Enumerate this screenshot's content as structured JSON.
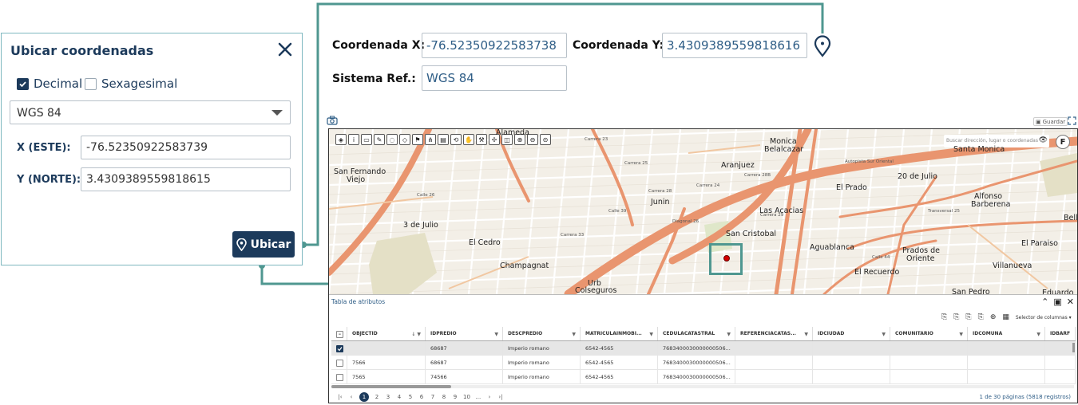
{
  "panel": {
    "title": "Ubicar coordenadas",
    "decimal_label": "Decimal",
    "decimal_checked": true,
    "sexagesimal_label": "Sexagesimal",
    "sexagesimal_checked": false,
    "crs_selected": "WGS 84",
    "x_label": "X (ESTE):",
    "x_value": "-76.52350922583739",
    "y_label": "Y (NORTE):",
    "y_value": "3.4309389559818615",
    "locate_button": "Ubicar"
  },
  "header": {
    "x_label": "Coordenada X:",
    "x_value": "-76.52350922583738",
    "y_label": "Coordenada Y:",
    "y_value": "3.4309389559818616",
    "ref_label": "Sistema Ref.:",
    "ref_value": "WGS 84"
  },
  "map": {
    "save_label": "Guardar",
    "search_placeholder": "Buscar dirección, lugar o coordenadas",
    "f_button": "F",
    "places": [
      {
        "name": "Alameda",
        "style": "left:209px;top:-1px;"
      },
      {
        "name": "Monica",
        "style": "left:552px;top:10px;"
      },
      {
        "name": "Belalcazar",
        "style": "left:545px;top:20px;"
      },
      {
        "name": "Santa Monica",
        "style": "left:782px;top:20px;"
      },
      {
        "name": "Aranjuez",
        "style": "left:491px;top:40px;"
      },
      {
        "name": "San Fernando",
        "style": "left:6px;top:48px;"
      },
      {
        "name": "Viejo",
        "style": "left:22px;top:58px;"
      },
      {
        "name": "20 de Julio",
        "style": "left:712px;top:54px;"
      },
      {
        "name": "El Prado",
        "style": "left:635px;top:68px;"
      },
      {
        "name": "Alfonso",
        "style": "left:808px;top:79px;"
      },
      {
        "name": "Barberena",
        "style": "left:804px;top:89px;"
      },
      {
        "name": "Junin",
        "style": "left:403px;top:86px;"
      },
      {
        "name": "Las Acacias",
        "style": "left:539px;top:97px;"
      },
      {
        "name": "Bello",
        "style": "left:920px;top:106px;"
      },
      {
        "name": "3 de Julio",
        "style": "left:93px;top:115px;"
      },
      {
        "name": "San Cristobal",
        "style": "left:497px;top:126px;"
      },
      {
        "name": "El Cedro",
        "style": "left:175px;top:137px;"
      },
      {
        "name": "Aguablanca",
        "style": "left:602px;top:143px;"
      },
      {
        "name": "El Paraiso",
        "style": "left:867px;top:138px;"
      },
      {
        "name": "Prados de",
        "style": "left:718px;top:147px;"
      },
      {
        "name": "Oriente",
        "style": "left:723px;top:157px;"
      },
      {
        "name": "Champagnat",
        "style": "left:214px;top:166px;"
      },
      {
        "name": "Villanueva",
        "style": "left:831px;top:166px;"
      },
      {
        "name": "El Recuerdo",
        "style": "left:658px;top:174px;"
      },
      {
        "name": "Urb",
        "style": "left:324px;top:188px;"
      },
      {
        "name": "Colseguros",
        "style": "left:308px;top:197px;"
      },
      {
        "name": "San Pedro",
        "style": "left:780px;top:199px;"
      },
      {
        "name": "Eduardo",
        "style": "left:893px;top:200px;"
      }
    ],
    "streets": [
      {
        "name": "Carrera 23",
        "style": "left:320px;top:10px;"
      },
      {
        "name": "Carrera 25",
        "style": "left:370px;top:40px;"
      },
      {
        "name": "Carrera 28",
        "style": "left:400px;top:75px;"
      },
      {
        "name": "Carrera 24",
        "style": "left:460px;top:68px;"
      },
      {
        "name": "Carrera 33",
        "style": "left:290px;top:130px;"
      },
      {
        "name": "Calle 39",
        "style": "left:350px;top:100px;"
      },
      {
        "name": "Diagonal 26",
        "style": "left:430px;top:113px;"
      },
      {
        "name": "Autopista Sur Oriental",
        "style": "left:646px;top:38px;"
      },
      {
        "name": "Transversal 25",
        "style": "left:750px;top:100px;"
      },
      {
        "name": "Calle 44",
        "style": "left:680px;top:158px;"
      },
      {
        "name": "Carrera 28B",
        "style": "left:520px;top:55px;"
      },
      {
        "name": "Calle 26",
        "style": "left:110px;top:80px;"
      },
      {
        "name": "Carrera 29",
        "style": "left:540px;top:105px;"
      }
    ]
  },
  "table": {
    "title": "Tabla de atributos",
    "column_selector": "Selector de columnas",
    "columns": [
      "OBJECTID",
      "IDPREDIO",
      "DESCPREDIO",
      "MATRICULAINMOBI...",
      "CEDULACATASTRAL",
      "REFERENCIACATAS...",
      "IDCIUDAD",
      "COMUNITARIO",
      "IDCOMUNA",
      "IDBARF"
    ],
    "rows": [
      {
        "checked": true,
        "cells": [
          "",
          "68687",
          "Imperio romano",
          "6542-4565",
          "7683400030000000506...",
          "",
          "",
          "",
          "",
          ""
        ]
      },
      {
        "checked": false,
        "cells": [
          "7566",
          "68687",
          "Imperio romano",
          "6542-4565",
          "7683400030000000506...",
          "",
          "",
          "",
          "",
          ""
        ]
      },
      {
        "checked": false,
        "cells": [
          "7565",
          "74566",
          "Imperio romano",
          "6542-4565",
          "7683400030000000506...",
          "",
          "",
          "",
          "",
          ""
        ]
      }
    ],
    "pages": [
      "1",
      "2",
      "3",
      "4",
      "5",
      "6",
      "7",
      "8",
      "9",
      "10",
      "..."
    ],
    "active_page": "1",
    "pager_info": "1 de 30 páginas (5818 registros)"
  },
  "colors": {
    "navy": "#1c3a5b",
    "teal": "#4f9790",
    "road": "#e9956f",
    "map_bg": "#f3efe7"
  }
}
